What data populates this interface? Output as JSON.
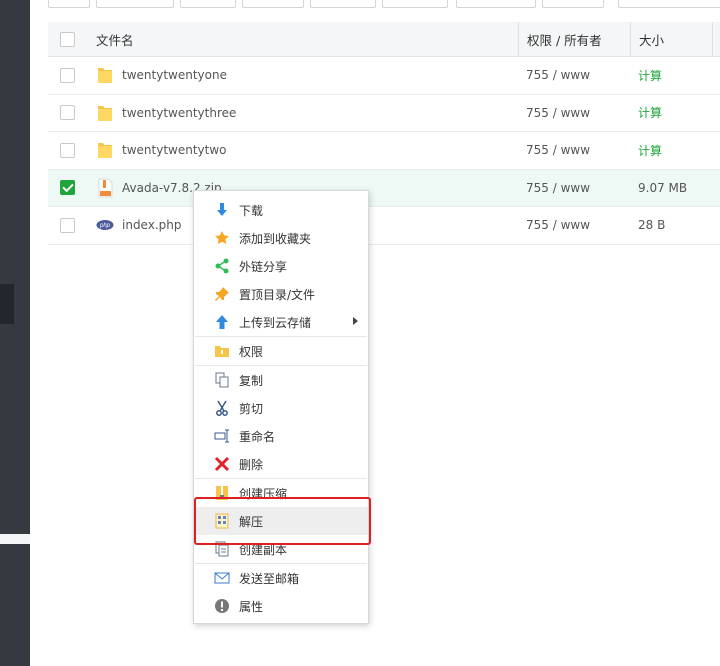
{
  "table": {
    "headers": {
      "name": "文件名",
      "perm": "权限 / 所有者",
      "size": "大小"
    },
    "rows": [
      {
        "name": "twentytwentyone",
        "type": "folder-icon",
        "perm": "755 / www",
        "size": "计算",
        "checked": false
      },
      {
        "name": "twentytwentythree",
        "type": "folder-icon",
        "perm": "755 / www",
        "size": "计算",
        "checked": false
      },
      {
        "name": "twentytwentytwo",
        "type": "folder-icon",
        "perm": "755 / www",
        "size": "计算",
        "checked": false
      },
      {
        "name": "Avada-v7.8.2.zip",
        "type": "zip-icon",
        "perm": "755 / www",
        "size": "9.07 MB",
        "checked": true
      },
      {
        "name": "index.php",
        "type": "php-icon",
        "perm": "755 / www",
        "size": "28 B",
        "checked": false
      }
    ]
  },
  "context_menu": {
    "items": [
      {
        "label": "下载",
        "icon": "download-arrow-icon"
      },
      {
        "label": "添加到收藏夹",
        "icon": "star-icon"
      },
      {
        "label": "外链分享",
        "icon": "share-icon"
      },
      {
        "label": "置顶目录/文件",
        "icon": "pin-icon"
      },
      {
        "label": "上传到云存储",
        "icon": "upload-arrow-icon"
      },
      {
        "label": "权限",
        "icon": "permission-folder-icon"
      },
      {
        "label": "复制",
        "icon": "copy-icon"
      },
      {
        "label": "剪切",
        "icon": "scissors-icon"
      },
      {
        "label": "重命名",
        "icon": "rename-icon"
      },
      {
        "label": "删除",
        "icon": "delete-x-icon"
      },
      {
        "label": "创建压缩",
        "icon": "compress-icon"
      },
      {
        "label": "解压",
        "icon": "extract-icon"
      },
      {
        "label": "创建副本",
        "icon": "duplicate-icon"
      },
      {
        "label": "发送至邮箱",
        "icon": "mail-icon"
      },
      {
        "label": "属性",
        "icon": "info-icon"
      }
    ]
  },
  "colors": {
    "accent": "#20a53a",
    "highlight": "#e02020"
  }
}
